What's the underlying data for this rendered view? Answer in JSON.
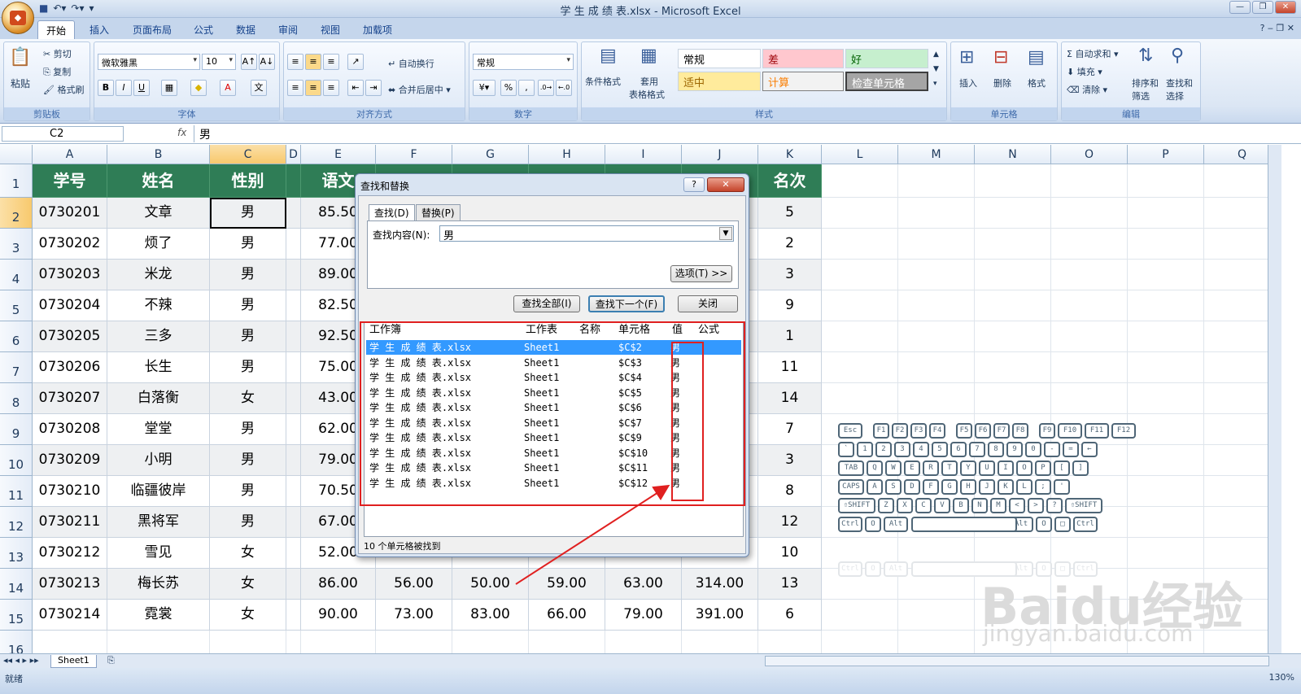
{
  "app": {
    "title": "学 生 成 绩 表.xlsx - Microsoft Excel"
  },
  "ribbon_tabs": [
    "开始",
    "插入",
    "页面布局",
    "公式",
    "数据",
    "审阅",
    "视图",
    "加载项"
  ],
  "clipboard": {
    "paste": "粘贴",
    "cut": "剪切",
    "copy": "复制",
    "format_painter": "格式刷",
    "label": "剪贴板"
  },
  "font": {
    "name": "微软雅黑",
    "size": "10",
    "label": "字体"
  },
  "align": {
    "wrap": "自动换行",
    "merge": "合并后居中",
    "label": "对齐方式"
  },
  "number": {
    "format": "常规",
    "percent": "%",
    "comma": ",",
    "label": "数字"
  },
  "styles": {
    "cond": "条件格式",
    "table1": "套用",
    "table2": "表格格式",
    "normal": "常规",
    "bad": "差",
    "good": "好",
    "neutral": "适中",
    "calc": "计算",
    "check": "检查单元格",
    "label": "样式"
  },
  "cells": {
    "insert": "插入",
    "delete": "删除",
    "format": "格式",
    "label": "单元格"
  },
  "editing": {
    "autosum": "自动求和",
    "fill": "填充",
    "clear": "清除",
    "sort": "排序和",
    "sort2": "筛选",
    "find": "查找和",
    "find2": "选择",
    "label": "编辑"
  },
  "formula_bar": {
    "name_box": "C2",
    "fx": "fx",
    "value": "男"
  },
  "columns": [
    "A",
    "B",
    "C",
    "D",
    "E",
    "F",
    "G",
    "H",
    "I",
    "J",
    "K",
    "L",
    "M",
    "N",
    "O",
    "P",
    "Q"
  ],
  "rows": [
    "1",
    "2",
    "3",
    "4",
    "5",
    "6",
    "7",
    "8",
    "9",
    "10",
    "11",
    "12",
    "13",
    "14",
    "15",
    "16"
  ],
  "table": {
    "headers": [
      "学号",
      "姓名",
      "性别",
      "语文",
      "",
      "",
      "",
      "",
      "",
      "名次"
    ],
    "data": [
      [
        "0730201",
        "文章",
        "男",
        "85.50",
        "",
        "",
        "",
        "",
        "",
        "5"
      ],
      [
        "0730202",
        "烦了",
        "男",
        "77.00",
        "",
        "",
        "",
        "",
        "",
        "2"
      ],
      [
        "0730203",
        "米龙",
        "男",
        "89.00",
        "",
        "",
        "",
        "",
        "",
        "3"
      ],
      [
        "0730204",
        "不辣",
        "男",
        "82.50",
        "",
        "",
        "",
        "",
        "",
        "9"
      ],
      [
        "0730205",
        "三多",
        "男",
        "92.50",
        "",
        "",
        "",
        "",
        "",
        "1"
      ],
      [
        "0730206",
        "长生",
        "男",
        "75.00",
        "",
        "",
        "",
        "",
        "",
        "11"
      ],
      [
        "0730207",
        "白落衡",
        "女",
        "43.00",
        "",
        "",
        "",
        "",
        "",
        "14"
      ],
      [
        "0730208",
        "堂堂",
        "男",
        "62.00",
        "",
        "",
        "",
        "",
        "",
        "7"
      ],
      [
        "0730209",
        "小明",
        "男",
        "79.00",
        "",
        "",
        "",
        "",
        "",
        "3"
      ],
      [
        "0730210",
        "临疆彼岸",
        "男",
        "70.50",
        "",
        "",
        "",
        "",
        "",
        "8"
      ],
      [
        "0730211",
        "黑将军",
        "男",
        "67.00",
        "",
        "",
        "",
        "",
        "",
        "12"
      ],
      [
        "0730212",
        "雪见",
        "女",
        "52.00",
        "",
        "",
        "",
        "",
        "",
        "10"
      ],
      [
        "0730213",
        "梅长苏",
        "女",
        "86.00",
        "56.00",
        "50.00",
        "59.00",
        "63.00",
        "314.00",
        "13"
      ],
      [
        "0730214",
        "霓裳",
        "女",
        "90.00",
        "73.00",
        "83.00",
        "66.00",
        "79.00",
        "391.00",
        "6"
      ]
    ]
  },
  "sheet_tab": "Sheet1",
  "status": {
    "ready": "就绪",
    "zoom": "130%"
  },
  "dialog": {
    "title": "查找和替换",
    "help": "?",
    "close_x": "✕",
    "tab_find": "查找(D)",
    "tab_replace": "替换(P)",
    "find_label": "查找内容(N):",
    "find_value": "男",
    "options": "选项(T) >>",
    "find_all": "查找全部(I)",
    "find_next": "查找下一个(F)",
    "close": "关闭",
    "cols": [
      "工作簿",
      "工作表",
      "名称",
      "单元格",
      "值",
      "公式"
    ],
    "results": [
      [
        "学 生 成 绩 表.xlsx",
        "Sheet1",
        "$C$2",
        "男"
      ],
      [
        "学 生 成 绩 表.xlsx",
        "Sheet1",
        "$C$3",
        "男"
      ],
      [
        "学 生 成 绩 表.xlsx",
        "Sheet1",
        "$C$4",
        "男"
      ],
      [
        "学 生 成 绩 表.xlsx",
        "Sheet1",
        "$C$5",
        "男"
      ],
      [
        "学 生 成 绩 表.xlsx",
        "Sheet1",
        "$C$6",
        "男"
      ],
      [
        "学 生 成 绩 表.xlsx",
        "Sheet1",
        "$C$7",
        "男"
      ],
      [
        "学 生 成 绩 表.xlsx",
        "Sheet1",
        "$C$9",
        "男"
      ],
      [
        "学 生 成 绩 表.xlsx",
        "Sheet1",
        "$C$10",
        "男"
      ],
      [
        "学 生 成 绩 表.xlsx",
        "Sheet1",
        "$C$11",
        "男"
      ],
      [
        "学 生 成 绩 表.xlsx",
        "Sheet1",
        "$C$12",
        "男"
      ]
    ],
    "status": "10 个单元格被找到"
  },
  "keyboard": {
    "row0": [
      "Esc",
      "F1",
      "F2",
      "F3",
      "F4",
      "F5",
      "F6",
      "F7",
      "F8",
      "F9",
      "F10",
      "F11",
      "F12"
    ],
    "row1": [
      "`",
      "1",
      "2",
      "3",
      "4",
      "5",
      "6",
      "7",
      "8",
      "9",
      "0",
      "-",
      "=",
      "←"
    ],
    "row2": [
      "TAB",
      "Q",
      "W",
      "E",
      "R",
      "T",
      "Y",
      "U",
      "I",
      "O",
      "P",
      "[",
      "]"
    ],
    "row3": [
      "CAPS",
      "A",
      "S",
      "D",
      "F",
      "G",
      "H",
      "J",
      "K",
      "L",
      ";",
      "'"
    ],
    "row4": [
      "⇧SHIFT",
      "Z",
      "X",
      "C",
      "V",
      "B",
      "N",
      "M",
      "<",
      ">",
      "?",
      "⇧SHIFT"
    ],
    "row5": [
      "Ctrl",
      "O",
      "Alt",
      "Alt",
      "O",
      "□",
      "Ctrl"
    ]
  },
  "watermark": {
    "logo": "Baidu经验",
    "url": "jingyan.baidu.com"
  },
  "colors": {
    "header_green": "#2f7d56",
    "accent_red": "#e02020",
    "select_blue": "#3399ff"
  }
}
